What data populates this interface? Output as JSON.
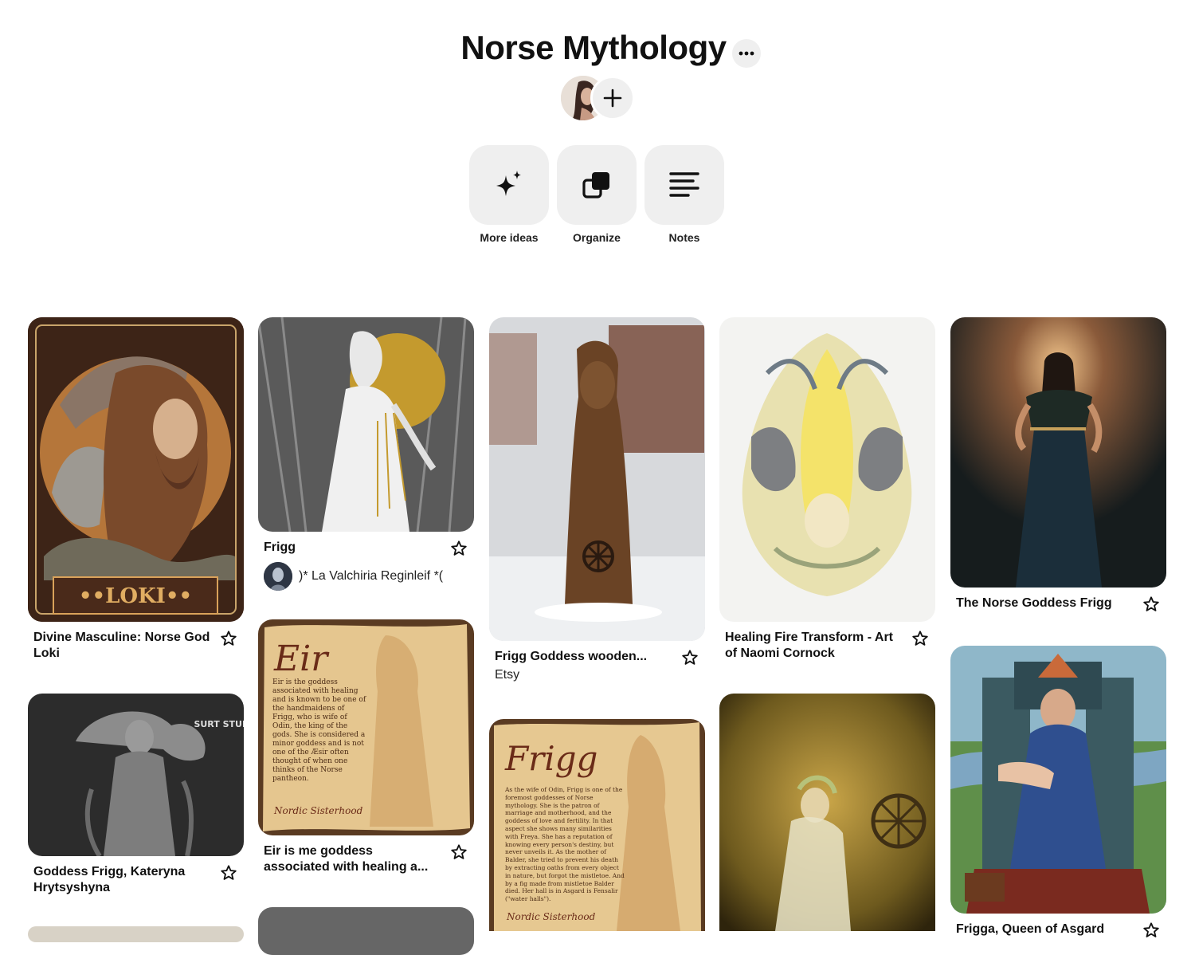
{
  "board": {
    "title": "Norse Mythology",
    "actions": [
      {
        "label": "More ideas",
        "icon": "sparkle-icon"
      },
      {
        "label": "Organize",
        "icon": "organize-icon"
      },
      {
        "label": "Notes",
        "icon": "notes-icon"
      }
    ]
  },
  "pins": [
    {
      "title": "Divine Masculine: Norse God Loki",
      "art_text": "••LOKI••"
    },
    {
      "title": "Goddess Frigg, Kateryna Hrytsyshyna",
      "art_text": "SURT STUDIO"
    },
    {
      "title": "Frigg",
      "owner": ")* La Valchiria Reginleif *("
    },
    {
      "title": "Eir is me goddess associated with healing a...",
      "art_title": "Eir",
      "art_text": "Eir is the goddess associated with healing and is known to be one of the handmaidens of Frigg, who is wife of Odin, the king of the gods. She is considered a minor goddess and is not one of the Æsir often thought of when one thinks of the Norse pantheon.",
      "art_sign": "Nordic Sisterhood"
    },
    {
      "title": "Frigg Goddess wooden...",
      "source": "Etsy"
    },
    {
      "art_title": "Frigg",
      "art_text": "As the wife of Odin, Frigg is one of the foremost goddesses of Norse mythology. She is the patron of marriage and motherhood, and the goddess of love and fertility. In that aspect she shows many similarities with Freya. She has a reputation of knowing every person's destiny, but never unveils it. As the mother of Balder, she tried to prevent his death by extracting oaths from every object in nature, but forgot the mistletoe. And by a fig made from mistletoe Balder died. Her hall is in Asgard is Fensalir (\"water halls\").",
      "art_sign": "Nordic Sisterhood"
    },
    {
      "title": "Healing Fire Transform - Art of Naomi Cornock"
    },
    {
      "title": "The Norse Goddess Frigg"
    },
    {
      "title": "Frigga, Queen of Asgard"
    }
  ],
  "colors": {
    "accent": "#111111",
    "chip": "#efefef",
    "background": "#ffffff"
  }
}
